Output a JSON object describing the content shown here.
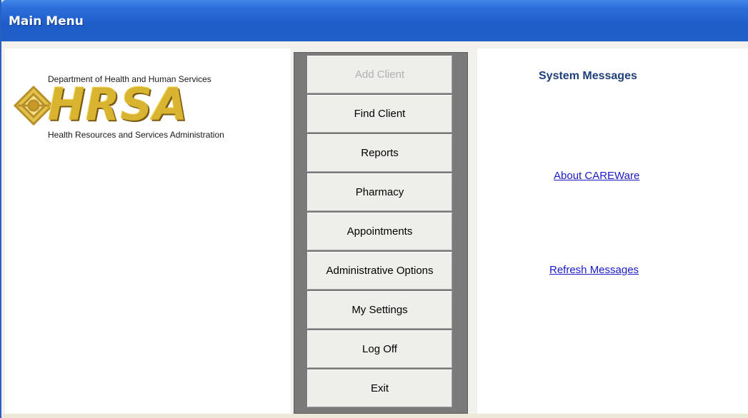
{
  "window": {
    "title": "Main Menu"
  },
  "logo": {
    "department": "Department of Health and Human Services",
    "wordmark": "HRSA",
    "agency": "Health Resources and Services Administration",
    "emblem_icon": "hrsa-emblem-icon"
  },
  "menu": {
    "buttons": [
      {
        "label": "Add Client",
        "enabled": false
      },
      {
        "label": "Find Client",
        "enabled": true
      },
      {
        "label": "Reports",
        "enabled": true
      },
      {
        "label": "Pharmacy",
        "enabled": true
      },
      {
        "label": "Appointments",
        "enabled": true
      },
      {
        "label": "Administrative Options",
        "enabled": true
      },
      {
        "label": "My Settings",
        "enabled": true
      },
      {
        "label": "Log Off",
        "enabled": true
      },
      {
        "label": "Exit",
        "enabled": true
      }
    ]
  },
  "messages": {
    "title": "System Messages",
    "about_link": "About CAREWare",
    "refresh_link": "Refresh Messages"
  },
  "colors": {
    "titlebar": "#2160c9",
    "link": "#1a1ac8",
    "heading": "#1f3f78",
    "logo_gold": "#d8b431"
  }
}
